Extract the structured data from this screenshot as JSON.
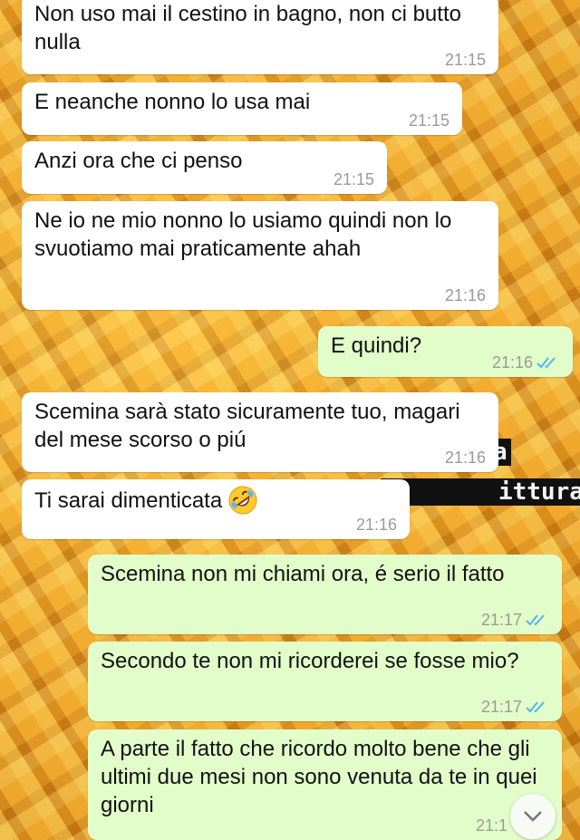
{
  "sticker": {
    "line1": "a",
    "line2": "ittura"
  },
  "messages": [
    {
      "direction": "in",
      "text": "Non uso mai il cestino in bagno, non ci butto nulla",
      "time": "21:15"
    },
    {
      "direction": "in",
      "text": "E neanche nonno lo usa mai",
      "time": "21:15"
    },
    {
      "direction": "in",
      "text": "Anzi ora che ci penso",
      "time": "21:15"
    },
    {
      "direction": "in",
      "text": "Ne io ne mio nonno lo usiamo quindi non lo svuotiamo mai praticamente ahah",
      "time": "21:16"
    },
    {
      "direction": "out",
      "text": "E quindi?",
      "time": "21:16",
      "status": "read"
    },
    {
      "direction": "in",
      "text": "Scemina sarà stato sicuramente tuo, magari del mese scorso o piú",
      "time": "21:16"
    },
    {
      "direction": "in",
      "text": "Ti sarai dimenticata",
      "time": "21:16",
      "emoji": "rolling-on-floor-laughing-emoji"
    },
    {
      "direction": "out",
      "text": "Scemina non mi chiami ora, é serio il fatto",
      "time": "21:17",
      "status": "read"
    },
    {
      "direction": "out",
      "text": "Secondo te non mi ricorderei se fosse mio?",
      "time": "21:17",
      "status": "read"
    },
    {
      "direction": "out",
      "text": "A parte il fatto che ricordo molto bene che gli ultimi due mesi non sono venuta da te in quei giorni",
      "time": "21:1"
    }
  ],
  "colors": {
    "incoming_bubble": "#ffffff",
    "outgoing_bubble": "#e2fdc9",
    "read_ticks": "#4fb6ec",
    "timestamp": "#9a9a9a"
  },
  "icons": {
    "read_receipt": "double-check-icon",
    "scroll_down": "chevron-down-icon"
  }
}
